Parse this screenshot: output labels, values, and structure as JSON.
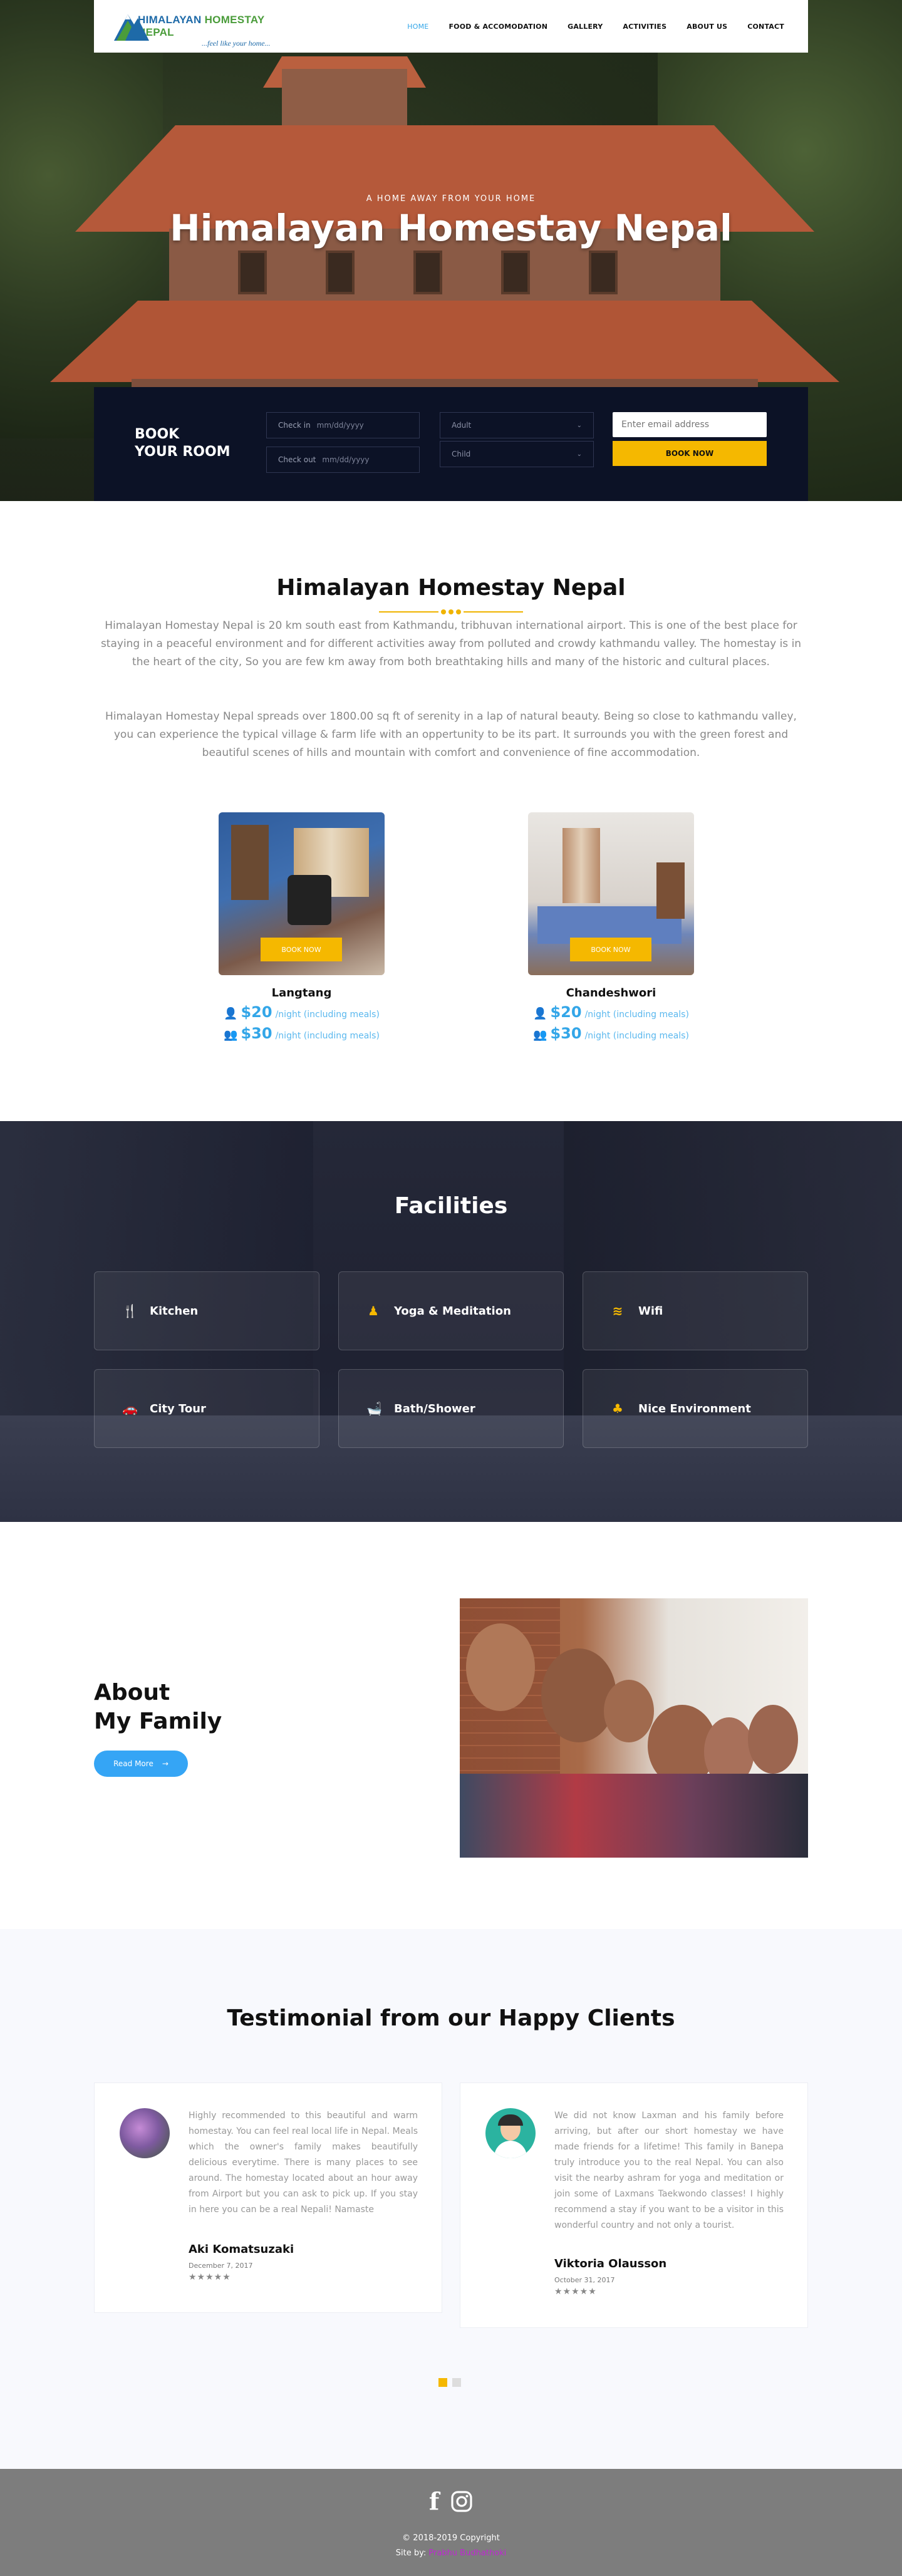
{
  "nav": {
    "logo_name_1": "HIMALAYAN ",
    "logo_name_2": "HOMESTAY NEPAL",
    "logo_tagline": "...feel like your home...",
    "items": [
      "HOME",
      "FOOD & ACCOMODATION",
      "GALLERY",
      "ACTIVITIES",
      "ABOUT US",
      "CONTACT"
    ],
    "active": "HOME"
  },
  "hero": {
    "subtitle": "A HOME AWAY FROM YOUR HOME",
    "title": "Himalayan Homestay Nepal"
  },
  "booking": {
    "heading_1": "BOOK",
    "heading_2": "YOUR ROOM",
    "checkin_label": "Check in",
    "checkin_placeholder": "mm/dd/yyyy",
    "checkout_label": "Check out",
    "checkout_placeholder": "mm/dd/yyyy",
    "adult_label": "Adult",
    "child_label": "Child",
    "email_placeholder": "Enter email address",
    "button": "BOOK NOW"
  },
  "about": {
    "title": "Himalayan Homestay Nepal",
    "para1": "Himalayan Homestay Nepal is 20 km south east from Kathmandu, tribhuvan international airport. This is one of the best place for staying in a peaceful environment and for different activities away from polluted and crowdy kathmandu valley. The homestay is in the heart of the city, So you are few km away from both breathtaking hills and many of the historic and cultural places.",
    "para2": "Himalayan Homestay Nepal spreads over 1800.00 sq ft of serenity in a lap of natural beauty. Being so close to kathmandu valley, you can experience the typical village & farm life with an oppertunity to be its part. It surrounds you with the green forest and beautiful scenes of hills and mountain with comfort and convenience of fine accommodation.",
    "rooms": [
      {
        "name": "Langtang",
        "button": "BOOK NOW",
        "price1": "$20",
        "unit1": "/night (including meals)",
        "price2": "$30",
        "unit2": "/night (including meals)"
      },
      {
        "name": "Chandeshwori",
        "button": "BOOK NOW",
        "price1": "$20",
        "unit1": "/night (including meals)",
        "price2": "$30",
        "unit2": "/night (including meals)"
      }
    ]
  },
  "facilities": {
    "title": "Facilities",
    "items": [
      {
        "label": "Kitchen",
        "icon": "utensils-icon",
        "glyph": "🍴"
      },
      {
        "label": "Yoga & Meditation",
        "icon": "person-icon",
        "glyph": "♟"
      },
      {
        "label": "Wifi",
        "icon": "wifi-icon",
        "glyph": "≋"
      },
      {
        "label": "City Tour",
        "icon": "car-icon",
        "glyph": "🚗"
      },
      {
        "label": "Bath/Shower",
        "icon": "bath-icon",
        "glyph": "🛁"
      },
      {
        "label": "Nice Environment",
        "icon": "tree-icon",
        "glyph": "♣"
      }
    ]
  },
  "family": {
    "title_1": "About",
    "title_2": "My Family",
    "button": "Read More"
  },
  "testimonials": {
    "title": "Testimonial from our Happy Clients",
    "items": [
      {
        "text": "Highly recommended to this beautiful and warm homestay. You can feel real local life in Nepal. Meals which the owner's family makes beautifully delicious everytime. There is many places to see around. The homestay located about an hour away from Airport but you can ask to pick up. If you stay in here you can be a real Nepali! Namaste",
        "name": "Aki Komatsuzaki",
        "date": "December 7, 2017",
        "stars": "★★★★★"
      },
      {
        "text": "We did not know Laxman and his family before arriving, but after our short homestay we have made friends for a lifetime! This family in Banepa truly introduce you to the real Nepal. You can also visit the nearby ashram for yoga and meditation or join some of Laxmans Taekwondo classes! I highly recommend a stay if you want to be a visitor in this wonderful country and not only a tourist.",
        "name": "Viktoria Olausson",
        "date": "October 31, 2017",
        "stars": "★★★★★"
      }
    ]
  },
  "footer": {
    "copyright": "© 2018-2019 Copyright",
    "site_by": "Site by: ",
    "author": "Prabhu Budhathoki"
  },
  "colors": {
    "accent_yellow": "#f5b800",
    "accent_blue": "#33a6e8",
    "booking_bg": "#0c1226",
    "footer_bg": "#7d7d7d"
  }
}
